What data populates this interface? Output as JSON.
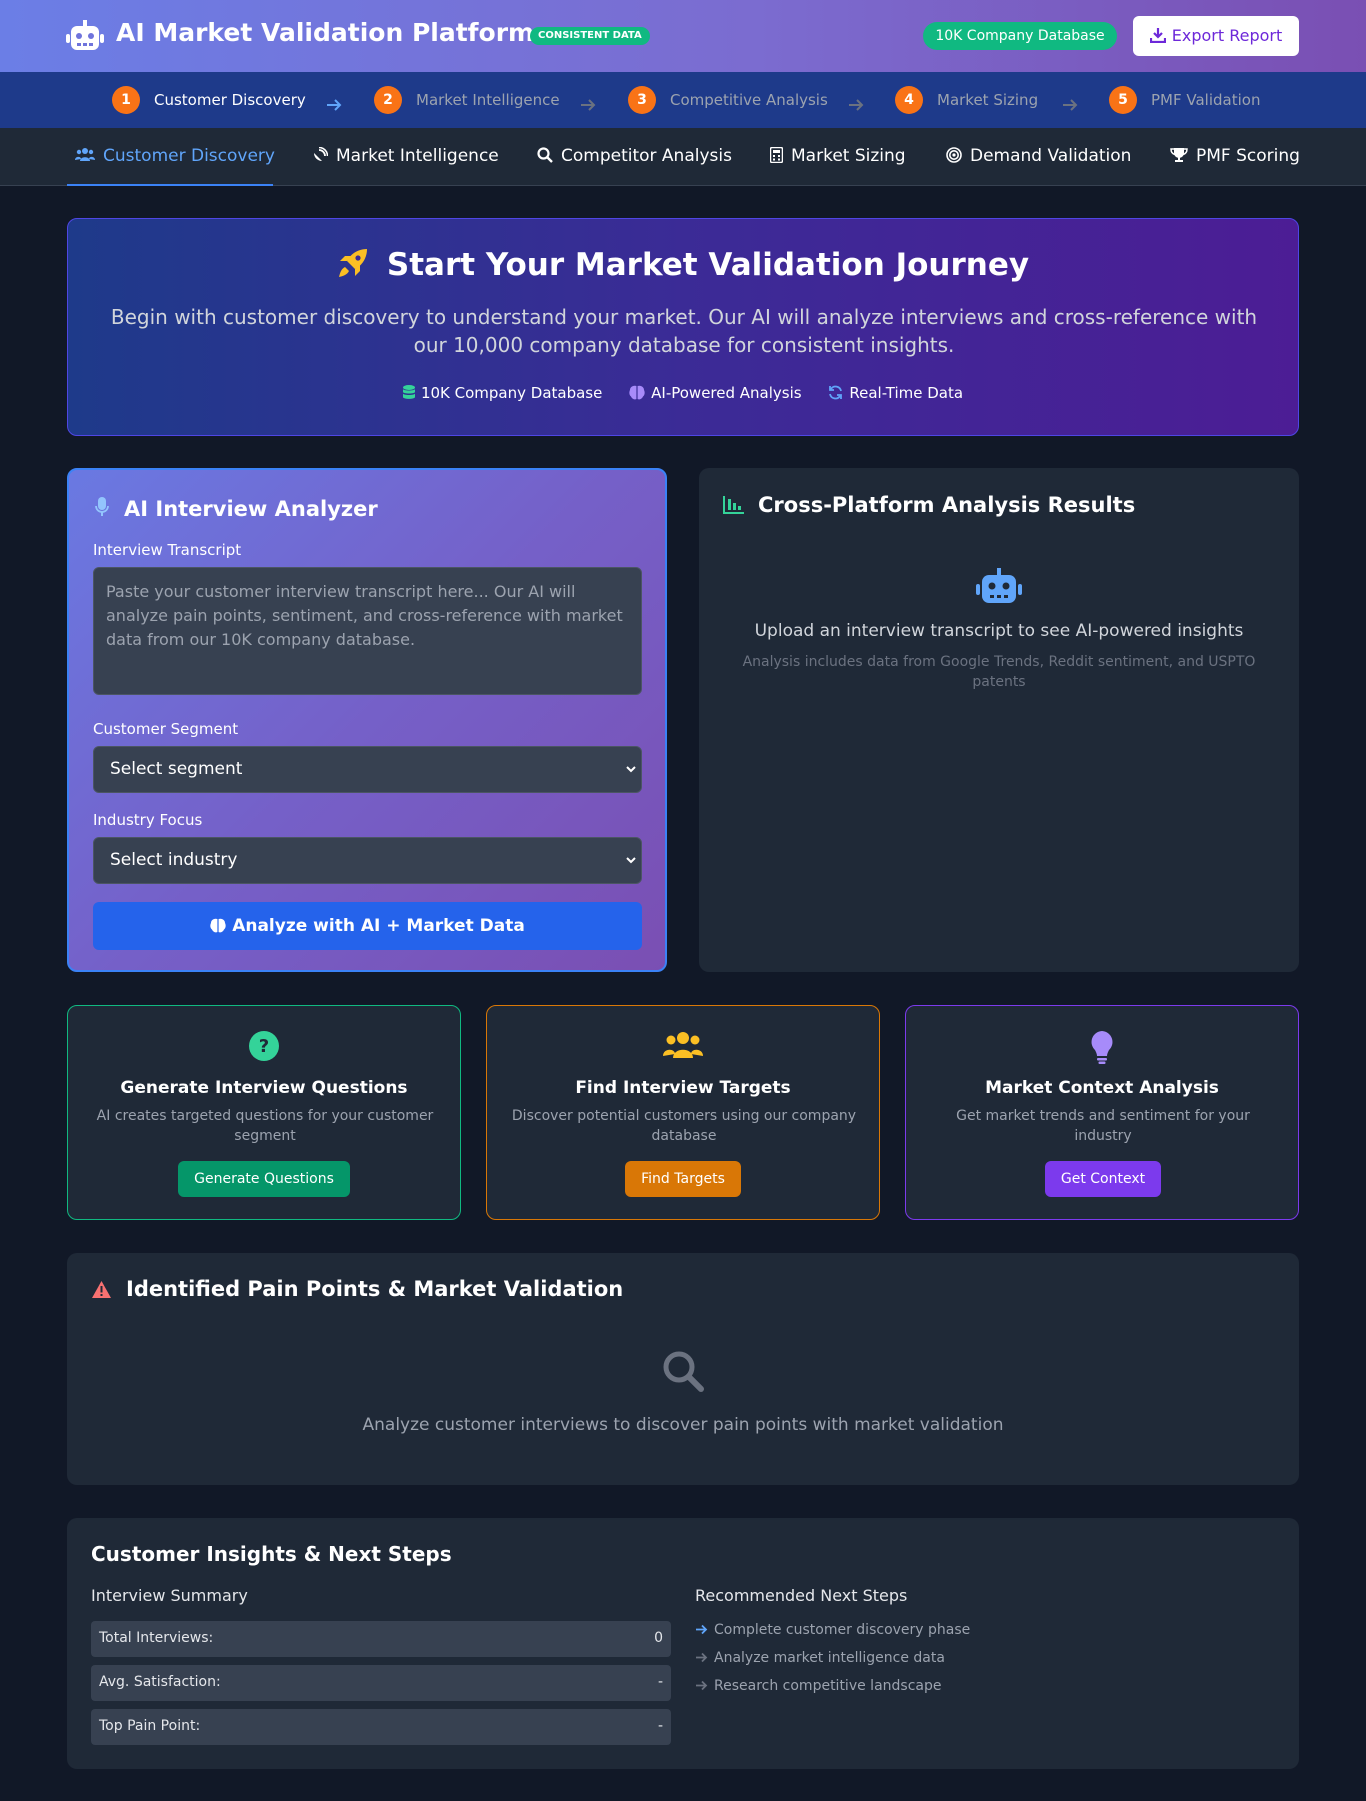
{
  "header": {
    "title": "AI Market Validation Platform",
    "badge": "CONSISTENT DATA",
    "db_badge": "10K Company Database",
    "export_label": "Export Report"
  },
  "steps": [
    {
      "num": "1",
      "label": "Customer Discovery"
    },
    {
      "num": "2",
      "label": "Market Intelligence"
    },
    {
      "num": "3",
      "label": "Competitive Analysis"
    },
    {
      "num": "4",
      "label": "Market Sizing"
    },
    {
      "num": "5",
      "label": "PMF Validation"
    }
  ],
  "tabs": [
    {
      "label": "Customer Discovery",
      "icon": "users-icon"
    },
    {
      "label": "Market Intelligence",
      "icon": "satellite-dish-icon"
    },
    {
      "label": "Competitor Analysis",
      "icon": "search-icon"
    },
    {
      "label": "Market Sizing",
      "icon": "calculator-icon"
    },
    {
      "label": "Demand Validation",
      "icon": "bullseye-icon"
    },
    {
      "label": "PMF Scoring",
      "icon": "trophy-icon"
    }
  ],
  "hero": {
    "title": "Start Your Market Validation Journey",
    "description": "Begin with customer discovery to understand your market. Our AI will analyze interviews and cross-reference with our 10,000 company database for consistent insights.",
    "features": [
      "10K Company Database",
      "AI-Powered Analysis",
      "Real-Time Data"
    ]
  },
  "analyzer": {
    "title": "AI Interview Analyzer",
    "transcript_label": "Interview Transcript",
    "transcript_placeholder": "Paste your customer interview transcript here... Our AI will analyze pain points, sentiment, and cross-reference with market data from our 10K company database.",
    "segment_label": "Customer Segment",
    "segment_value": "Select segment",
    "industry_label": "Industry Focus",
    "industry_value": "Select industry",
    "analyze_label": "Analyze with AI + Market Data"
  },
  "results": {
    "title": "Cross-Platform Analysis Results",
    "message": "Upload an interview transcript to see AI-powered insights",
    "sub": "Analysis includes data from Google Trends, Reddit sentiment, and USPTO patents"
  },
  "actions": [
    {
      "title": "Generate Interview Questions",
      "desc": "AI creates targeted questions for your customer segment",
      "button": "Generate Questions",
      "color": "#059669"
    },
    {
      "title": "Find Interview Targets",
      "desc": "Discover potential customers using our company database",
      "button": "Find Targets",
      "color": "#d97706"
    },
    {
      "title": "Market Context Analysis",
      "desc": "Get market trends and sentiment for your industry",
      "button": "Get Context",
      "color": "#7c3aed"
    }
  ],
  "pain": {
    "title": "Identified Pain Points & Market Validation",
    "message": "Analyze customer interviews to discover pain points with market validation"
  },
  "insights": {
    "title": "Customer Insights & Next Steps",
    "summary_title": "Interview Summary",
    "stats": [
      {
        "label": "Total Interviews:",
        "value": "0"
      },
      {
        "label": "Avg. Satisfaction:",
        "value": "-"
      },
      {
        "label": "Top Pain Point:",
        "value": "-"
      }
    ],
    "next_title": "Recommended Next Steps",
    "next_steps": [
      "Complete customer discovery phase",
      "Analyze market intelligence data",
      "Research competitive landscape"
    ]
  },
  "colors": {
    "accent": "#3b82f6",
    "step_circle": "#f97316",
    "success": "#10b981",
    "background": "#111827",
    "panel": "#1f2937"
  }
}
